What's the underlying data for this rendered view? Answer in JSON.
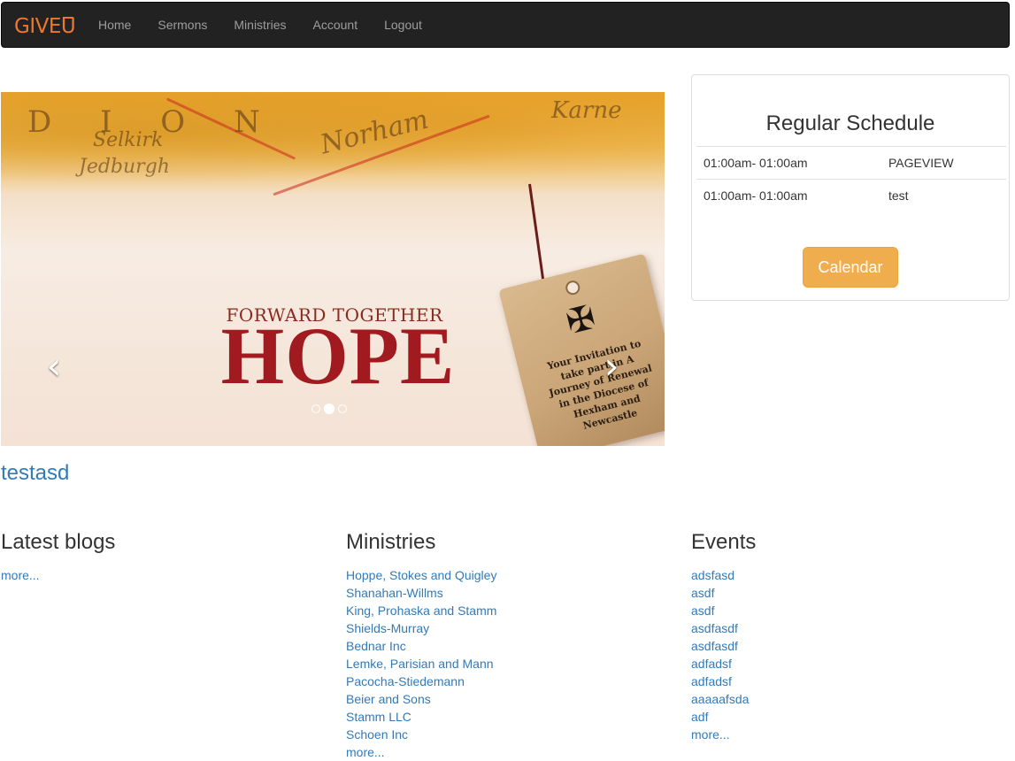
{
  "nav": {
    "brand_main": "GIVE",
    "brand_suffix": "U",
    "links": [
      "Home",
      "Sermons",
      "Ministries",
      "Account",
      "Logout"
    ]
  },
  "carousel": {
    "slide_small": "FORWARD TOGETHER",
    "slide_big": "HOPE",
    "tag_text": "Your Invitation to take part in A Journey of Renewal in the Diocese of Hexham and Newcastle",
    "prev_glyph": "‹",
    "next_glyph": "›",
    "indicator_count": 3,
    "active_indicator": 1
  },
  "schedule": {
    "title": "Regular Schedule",
    "rows": [
      {
        "time": "01:00am- 01:00am",
        "name": "PAGEVIEW"
      },
      {
        "time": "01:00am- 01:00am",
        "name": "test"
      }
    ],
    "button": "Calendar"
  },
  "page": {
    "heading": "testasd"
  },
  "blogs": {
    "title": "Latest blogs",
    "more": "more..."
  },
  "ministries": {
    "title": "Ministries",
    "items": [
      "Hoppe, Stokes and Quigley",
      "Shanahan-Willms",
      "King, Prohaska and Stamm",
      "Shields-Murray",
      "Bednar Inc",
      "Lemke, Parisian and Mann",
      "Pacocha-Stiedemann",
      "Beier and Sons",
      "Stamm LLC",
      "Schoen Inc"
    ],
    "more": "more..."
  },
  "events": {
    "title": "Events",
    "items": [
      "adsfasd",
      "asdf",
      "asdf",
      "asdfasdf",
      "asdfasdf",
      "adfadsf",
      "adfadsf",
      "aaaaafsda",
      "adf"
    ],
    "more": "more..."
  },
  "colors": {
    "navbar": "#222222",
    "brand": "#f0762c",
    "link": "#337ab7",
    "button": "#f0ad4e"
  }
}
